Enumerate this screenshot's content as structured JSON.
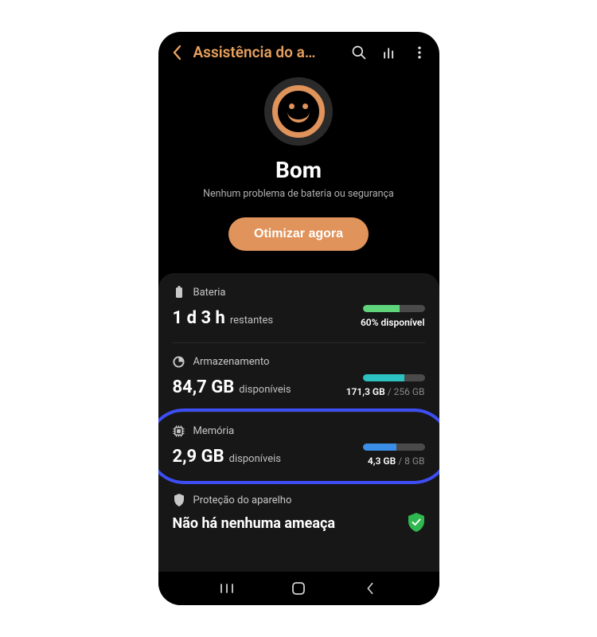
{
  "header": {
    "title": "Assistência do a…"
  },
  "hero": {
    "status": "Bom",
    "subtitle": "Nenhum problema de bateria ou segurança",
    "optimize_label": "Otimizar agora"
  },
  "colors": {
    "accent": "#e0935a",
    "battery_bar": "#5fd47a",
    "storage_bar": "#2cc2c2",
    "memory_bar": "#3b8ee8",
    "highlight": "#3d4ef5"
  },
  "cards": {
    "battery": {
      "label": "Bateria",
      "value": "1 d 3 h",
      "suffix": "restantes",
      "right_text": "60% disponível",
      "bar_percent": 60
    },
    "storage": {
      "label": "Armazenamento",
      "value": "84,7 GB",
      "suffix": "disponíveis",
      "right_used": "171,3 GB",
      "right_total": "256 GB",
      "bar_percent": 67
    },
    "memory": {
      "label": "Memória",
      "value": "2,9 GB",
      "suffix": "disponíveis",
      "right_used": "4,3 GB",
      "right_total": "8 GB",
      "bar_percent": 54
    },
    "protection": {
      "label": "Proteção do aparelho",
      "value": "Não há nenhuma ameaça"
    }
  }
}
